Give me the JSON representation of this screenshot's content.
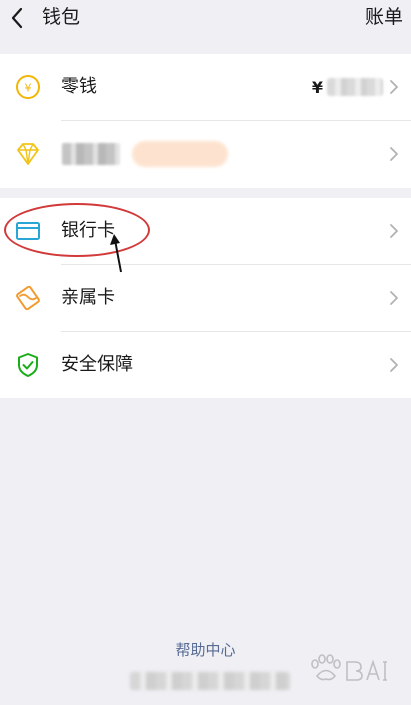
{
  "header": {
    "back_icon": "chevron-left-icon",
    "title": "钱包",
    "action_label": "账单"
  },
  "top_group": {
    "items": [
      {
        "label": "零钱",
        "icon": "yuan-coin-icon",
        "icon_color": "#f2b705",
        "value_prefix": "¥"
      },
      {
        "icon": "diamond-icon",
        "icon_color": "#f2c417"
      }
    ]
  },
  "bottom_group": {
    "items": [
      {
        "label": "银行卡",
        "icon": "bank-card-icon",
        "icon_color": "#2aa6d6"
      },
      {
        "label": "亲属卡",
        "icon": "family-card-icon",
        "icon_color": "#f39b2f"
      },
      {
        "label": "安全保障",
        "icon": "shield-check-icon",
        "icon_color": "#1aad19"
      }
    ]
  },
  "footer": {
    "help_link": "帮助中心"
  },
  "colors": {
    "page_background": "#efeff4",
    "card_background": "#ffffff",
    "link": "#576b95",
    "annotation": "#d23a3a"
  }
}
